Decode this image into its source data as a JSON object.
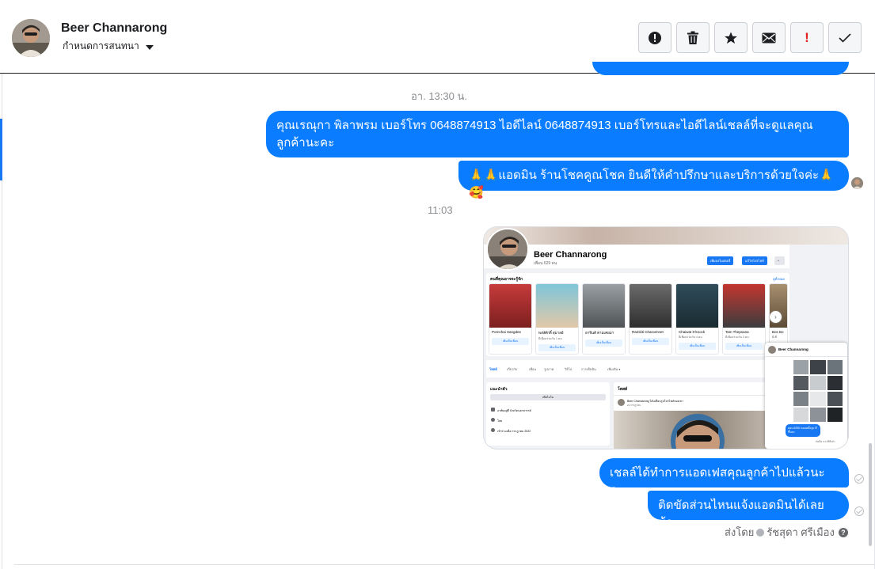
{
  "header": {
    "contact_name": "Beer Channarong",
    "assign_label": "กำหนดการสนทนา",
    "actions": [
      {
        "name": "spam-button",
        "icon": "alert-circle-icon"
      },
      {
        "name": "delete-button",
        "icon": "trash-icon"
      },
      {
        "name": "star-button",
        "icon": "star-icon"
      },
      {
        "name": "mark-unread-button",
        "icon": "envelope-icon"
      },
      {
        "name": "follow-up-button",
        "icon": "exclamation-icon",
        "glyph": "!"
      },
      {
        "name": "mark-done-button",
        "icon": "checkmark-icon"
      }
    ]
  },
  "thread": {
    "timestamp_1": "อา. 13:30 น.",
    "messages": [
      {
        "text": "คุณเรณุกา พิลาพรม        เบอร์โทร 0648874913  ไอดีไลน์ 0648874913   เบอร์โทรและไอดีไลน์เชลล์ที่จะดูแลคุณลูกค้านะคะ"
      },
      {
        "text": "🙏🙏แอดมิน ร้านโชคคูณโชค ยินดีให้คำปรึกษาและบริการด้วยใจค่ะ🙏🥰"
      }
    ],
    "timestamp_2": "11:03",
    "shared_screenshot": {
      "profile_name": "Beer Channarong",
      "profile_sub": "เพื่อน 629 คน",
      "btn_add_story": "เพิ่มลงในสตอรี่",
      "btn_edit": "แก้ไขโปรไฟล์",
      "suggest_title": "คนที่คุณอาจจะรู้จัก",
      "suggest_all": "ดูทั้งหมด",
      "people": [
        {
          "name": "Pornchai Sangdee",
          "meta": ""
        },
        {
          "name": "พงษ์ศักดิ์ สุมาลย์",
          "meta": "มีเพื่อนร่วมกัน 1 คน"
        },
        {
          "name": "อาจินต์ ตามเคยมา",
          "meta": ""
        },
        {
          "name": "Ramkiti Charoennet",
          "meta": ""
        },
        {
          "name": "Chaiwat K'knock",
          "meta": "มีเพื่อนร่วมกัน 4 คน"
        },
        {
          "name": "Tam Thepsana",
          "meta": "มีเพื่อนร่วมกัน 3 คน"
        },
        {
          "name": "Bos Bo",
          "meta": "มีเพื่"
        }
      ],
      "add_friend_label": "เพิ่มเป็นเพื่อน",
      "tabs": [
        "โพสต์",
        "เกี่ยวกับ",
        "เพื่อน",
        "รูปภาพ",
        "วิดีโอ",
        "การเช็คอิน",
        "เพิ่มเติม ▾"
      ],
      "intro_title": "แนะนำตัว",
      "intro_btn": "เพิ่มไบโอ",
      "intro_lines": [
        "อาศัยอยู่ที่ จังหวัดนครสวรรค์",
        "โสด",
        "เข้าร่วมเมื่อ กรกฎาคม 2022"
      ],
      "posts_title": "โพสต์",
      "post_author": "Beer Channarong ได้เปลี่ยนรูปโปรไฟล์ของเขา",
      "post_date": "22 กรกฎาคม ·",
      "minichat_name": "Beer Channarong",
      "minichat_bubble": "สอบ 6250 ดอนสตั้งจูบ ดีขึ้นนะ",
      "minichat_meta": "ส่งเมื่อ 6 นาทีที่แล้ว"
    },
    "messages_after": [
      {
        "text": "เชลล์ได้ทำการแอดเฟสคุณลูกค้าไปแล้วนะคะ"
      },
      {
        "text": "ติดขัดส่วนไหนแจ้งแอดมินได้เลยน้า"
      }
    ],
    "sent_by_label": "ส่งโดย",
    "sent_by_name": "รัชสุดา ศรีเมือง"
  },
  "colors": {
    "bubble": "#0a7cff",
    "accent": "#1877f2",
    "timestamp": "#8a8d91"
  }
}
